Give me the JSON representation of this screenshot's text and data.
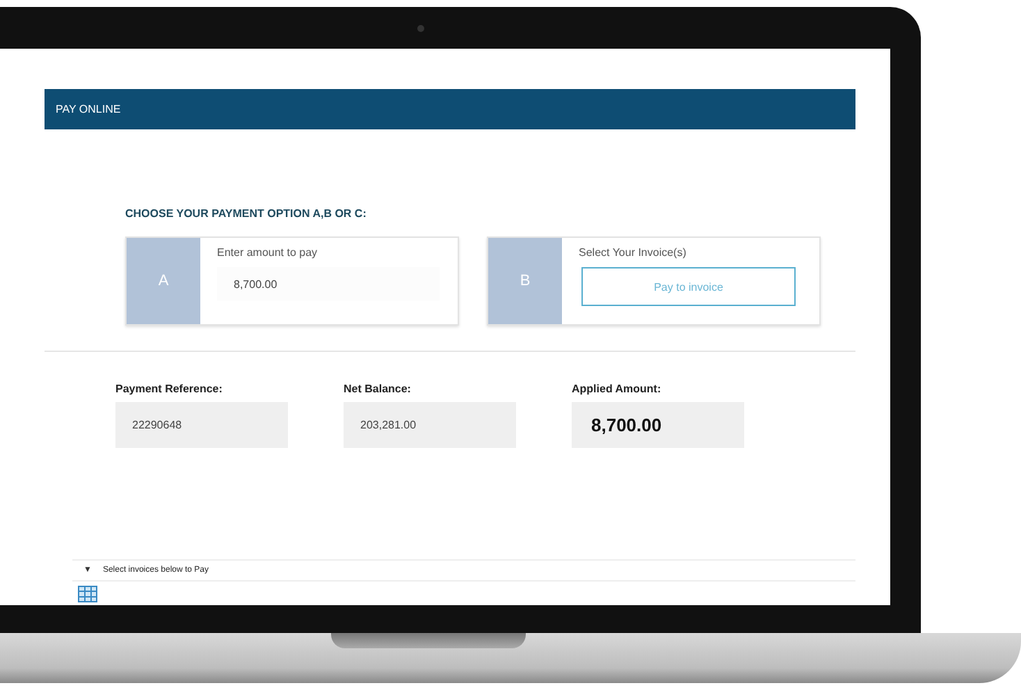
{
  "header": {
    "title": "PAY ONLINE"
  },
  "instructions": "CHOOSE YOUR PAYMENT OPTION A,B OR C:",
  "options": [
    {
      "kind": "amount",
      "letter": "A",
      "label": "Enter amount to pay",
      "value": "8,700.00"
    },
    {
      "kind": "invoice",
      "letter": "B",
      "label": "Select Your Invoice(s)",
      "button": "Pay to invoice"
    }
  ],
  "summary": [
    {
      "label": "Payment Reference:",
      "value": "22290648",
      "emphasis": false
    },
    {
      "label": "Net Balance:",
      "value": "203,281.00",
      "emphasis": false
    },
    {
      "label": "Applied Amount:",
      "value": "8,700.00",
      "emphasis": true
    }
  ],
  "invoices_section": {
    "toggle": "▼",
    "title": "Select invoices below to Pay"
  }
}
